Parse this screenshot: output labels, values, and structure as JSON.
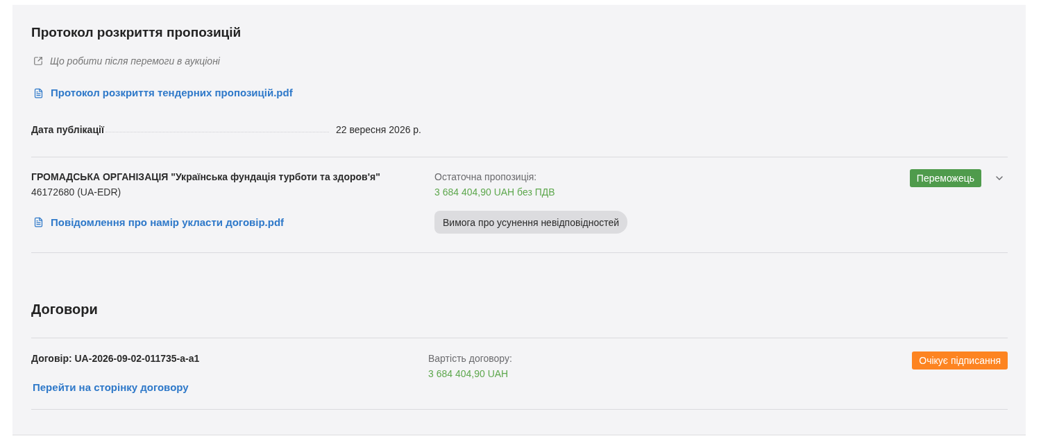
{
  "protocol": {
    "title": "Протокол розкриття пропозицій",
    "help_link": "Що робити після перемоги в аукціоні",
    "document": "Протокол розкриття тендерних пропозицій.pdf",
    "published": {
      "label": "Дата публікації",
      "value": "22 вересня 2026 р."
    }
  },
  "bids": [
    {
      "supplier": "ГРОМАДСЬКА ОРГАНІЗАЦІЯ \"Українська фундація турботи та здоров'я\"",
      "supplier_id": "46172680 (UA-EDR)",
      "document": "Повідомлення про намір укласти договір.pdf",
      "offer_label": "Остаточна пропозиція:",
      "offer_value": "3 684 404,90 UAH без ПДВ",
      "claim_button": "Вимога про усунення невідповідностей",
      "status": {
        "kind": "winner",
        "label": "Переможець"
      },
      "expanded": false
    }
  ],
  "contracts": {
    "title": "Договори",
    "items": [
      {
        "number": "Договір: UA-2026-09-02-011735-a-a1",
        "link": "Перейти на сторінку договору",
        "value_label": "Вартість договору:",
        "value": "3 684 404,90 UAH",
        "status": {
          "kind": "pending",
          "label": "Очікує підписання"
        }
      }
    ]
  }
}
